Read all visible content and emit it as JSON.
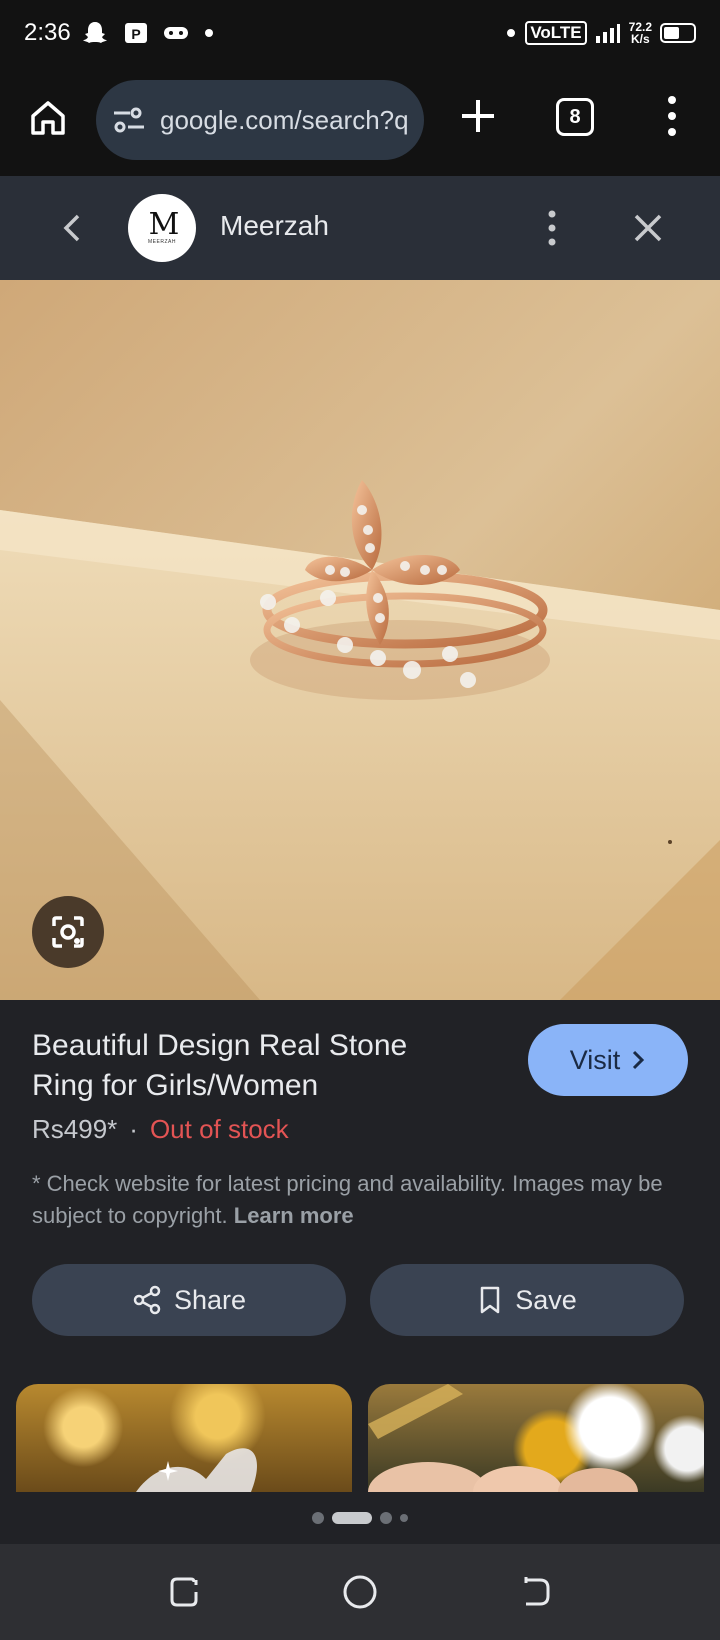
{
  "status_bar": {
    "time": "2:36",
    "network": "VoLTE",
    "speed_value": "72.2",
    "speed_unit": "K/s",
    "battery_level": 0.55,
    "left_icons": [
      "snapchat-icon",
      "paytm-icon",
      "gamepad-icon",
      "dot-icon"
    ],
    "right_icons": [
      "dot-icon",
      "volte-icon",
      "signal-icon",
      "battery-icon"
    ]
  },
  "browser": {
    "url": "google.com/search?q",
    "tab_count": "8",
    "icons": [
      "home-icon",
      "site-settings-icon",
      "plus-icon",
      "tabs-icon",
      "more-vert-icon"
    ]
  },
  "panel": {
    "brand_name": "Meerzah",
    "logo_text": "M",
    "logo_subtext": "MEERZAH",
    "icons": [
      "chevron-left-icon",
      "more-vert-icon",
      "close-icon"
    ]
  },
  "product": {
    "title": "Beautiful Design Real Stone Ring for Girls/Women",
    "price": "Rs499*",
    "separator": "·",
    "availability": "Out of stock",
    "disclaimer": "* Check website for latest pricing and availability. Images may be subject to copyright.",
    "learn_more": "Learn more",
    "visit_label": "Visit",
    "share_label": "Share",
    "save_label": "Save"
  },
  "pager": {
    "pages": 4,
    "active_index": 1
  },
  "colors": {
    "accent": "#8ab4f8",
    "out_of_stock": "#e35454",
    "panel_bg": "#2a2f38",
    "button_bg": "#3a4352"
  }
}
